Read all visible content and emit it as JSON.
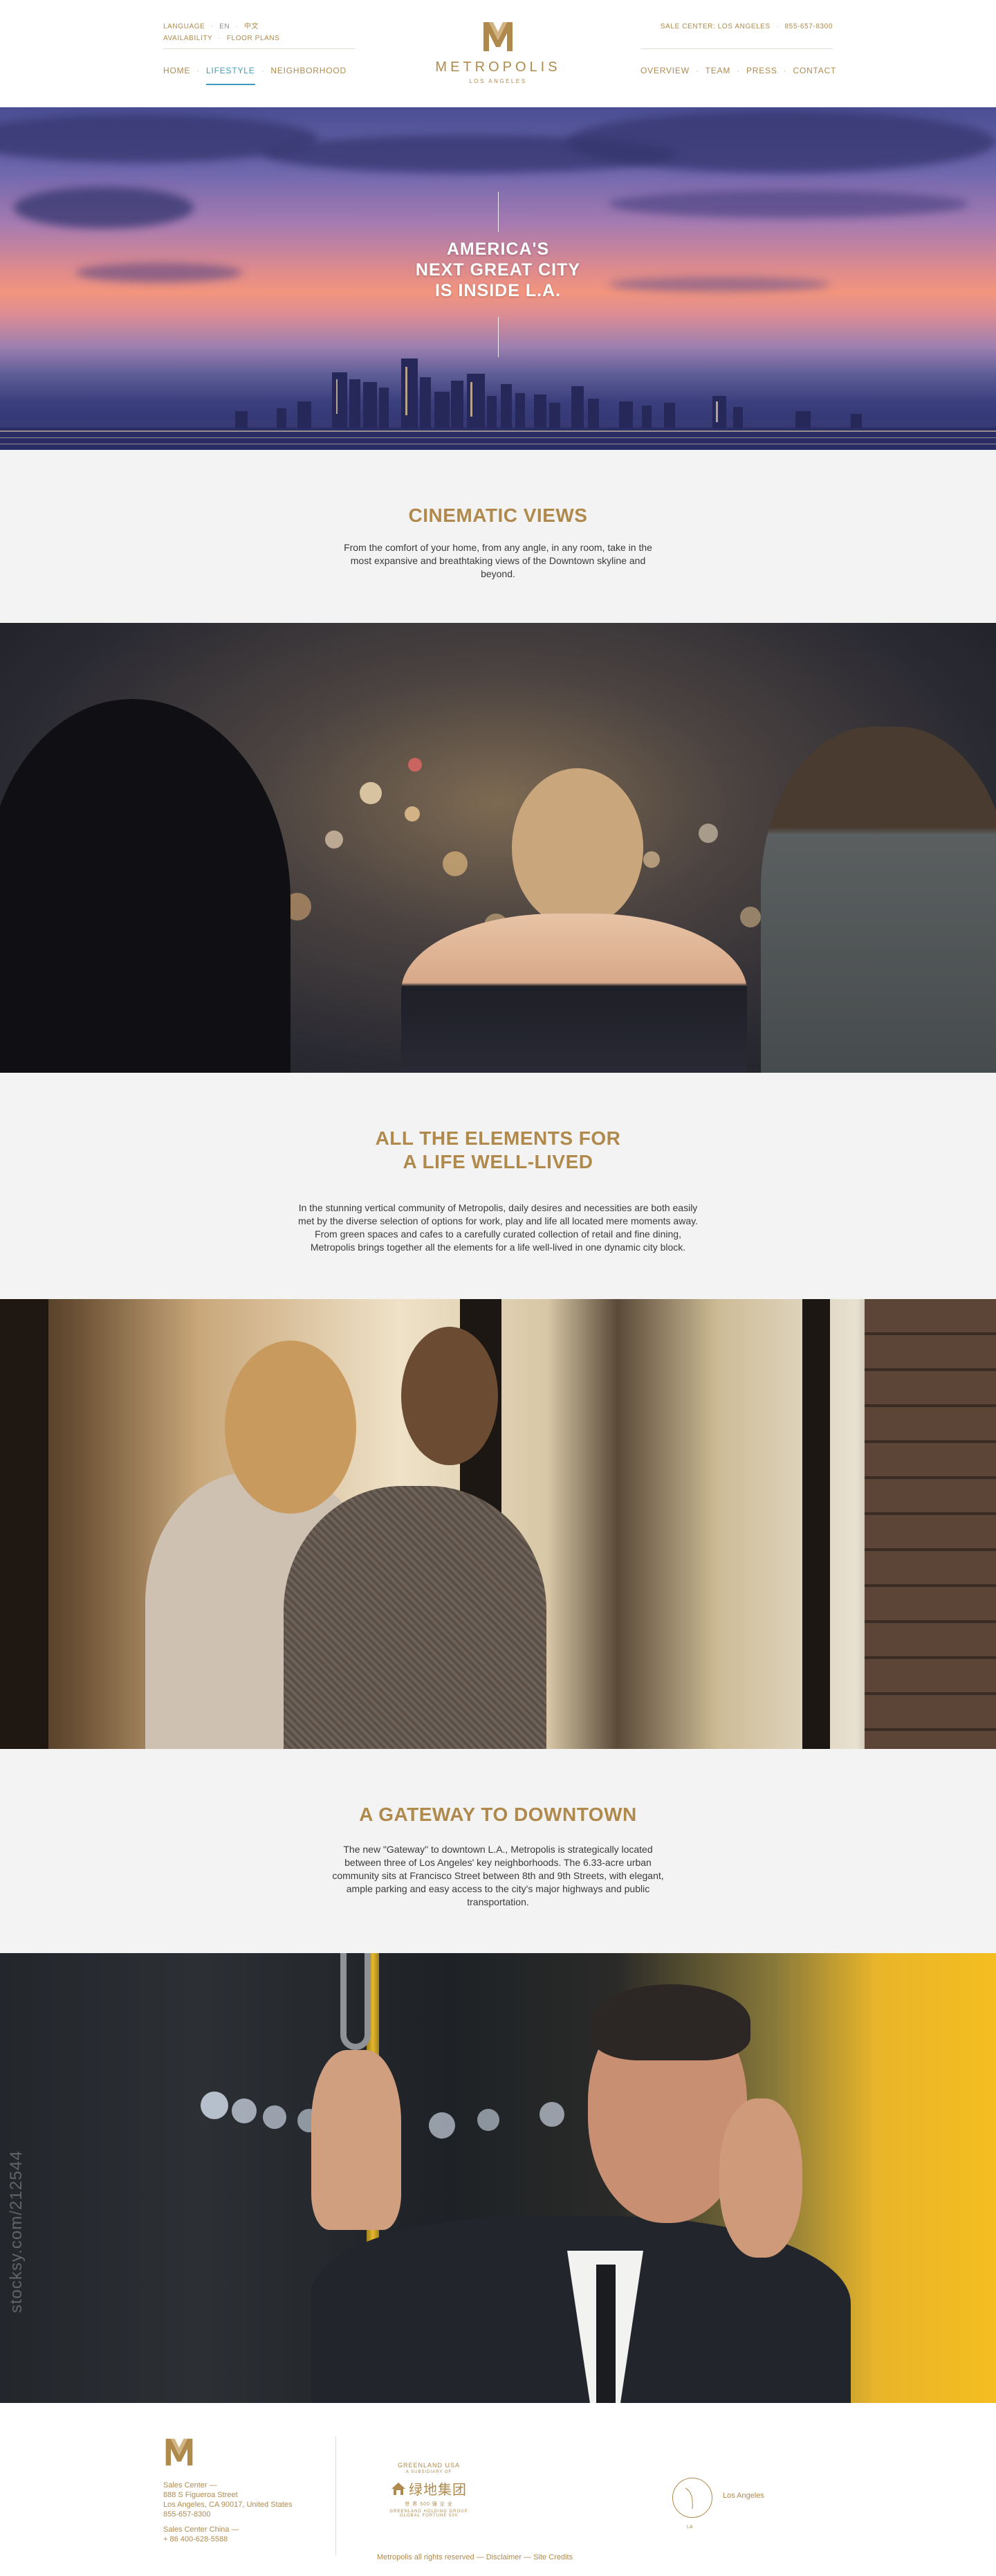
{
  "header": {
    "utility_left": {
      "language_label": "LANGUAGE",
      "lang_en": "EN",
      "lang_zh": "中文",
      "availability": "AVAILABILITY",
      "floor_plans": "FLOOR PLANS"
    },
    "nav_left": [
      {
        "label": "HOME",
        "active": false
      },
      {
        "label": "LIFESTYLE",
        "active": true
      },
      {
        "label": "NEIGHBORHOOD",
        "active": false
      }
    ],
    "brand": {
      "name": "METROPOLIS",
      "sub": "LOS ANGELES"
    },
    "utility_right": {
      "sales_center": "SALE CENTER: LOS ANGELES",
      "phone": "855-657-8300"
    },
    "nav_right": [
      {
        "label": "OVERVIEW"
      },
      {
        "label": "TEAM"
      },
      {
        "label": "PRESS"
      },
      {
        "label": "CONTACT"
      }
    ]
  },
  "hero": {
    "line1": "AMERICA'S",
    "line2": "NEXT GREAT CITY",
    "line3": "IS INSIDE L.A."
  },
  "sections": [
    {
      "title": "CINEMATIC VIEWS",
      "body": "From the comfort of your home, from any angle, in any room, take in the most expansive and breathtaking views of the Downtown skyline and beyond."
    },
    {
      "title_line1": "ALL THE ELEMENTS FOR",
      "title_line2": "A LIFE WELL-LIVED",
      "body": "In the stunning vertical community of Metropolis, daily desires and necessities are both easily met by the diverse selection of options for work, play and life all located mere moments away. From green spaces and cafes to a carefully curated collection of retail and fine dining, Metropolis brings together all the elements for a life well-lived in one dynamic city block."
    },
    {
      "title": "A GATEWAY TO DOWNTOWN",
      "body": "The new \"Gateway\" to downtown L.A., Metropolis is strategically located between three of Los Angeles' key neighborhoods. The 6.33-acre urban community sits at Francisco Street between 8th and 9th Streets, with elegant, ample parking and easy access to the city's major highways and public transportation."
    }
  ],
  "watermark": "stocksy.com/212544",
  "footer": {
    "address": {
      "sales_center": "Sales Center —",
      "street": "888 S Figueroa Street",
      "city": "Los Angeles, CA 90017, United States",
      "phone": "855-657-8300",
      "china_label": "Sales Center China —",
      "china_phone": "+ 86 400-628-5588"
    },
    "greenland": {
      "top": "GREENLAND USA",
      "top_sub": "A SUBSIDIARY OF",
      "chinese": "绿地集团",
      "sub_chinese": "世 界 500 强 企 业",
      "bottom": "GREENLAND HOLDING GROUP",
      "bottom_sub": "GLOBAL FORTUNE 500"
    },
    "legal": {
      "rights": "Metropolis all rights reserved",
      "disclaimer": "Disclaimer",
      "credits": "Site Credits"
    },
    "la_label": "Los Angeles",
    "circle_caption": "LA"
  },
  "colors": {
    "gold": "#b08a4c",
    "active_nav": "#3d9cbd",
    "section_bg": "#f3f3f3"
  }
}
